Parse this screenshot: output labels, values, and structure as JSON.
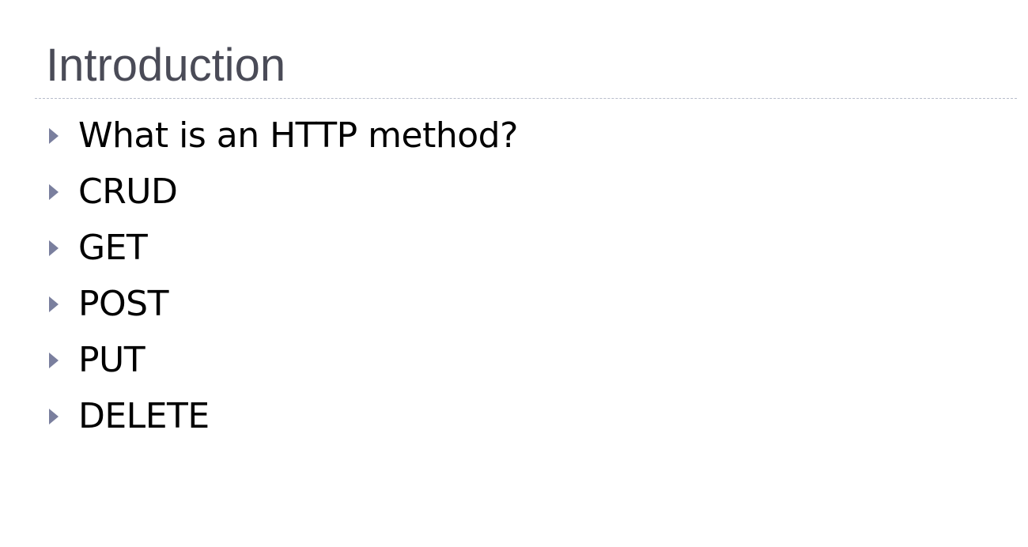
{
  "slide": {
    "title": "Introduction",
    "bullets": [
      {
        "text": "What is an HTTP method?"
      },
      {
        "text": "CRUD"
      },
      {
        "text": "GET"
      },
      {
        "text": "POST"
      },
      {
        "text": "PUT"
      },
      {
        "text": "DELETE"
      }
    ]
  },
  "colors": {
    "title": "#4a4b57",
    "bullet_marker": "#7a7f9e",
    "rule": "#b7bccb",
    "text": "#000000",
    "background": "#ffffff"
  },
  "icons": {
    "bullet": "triangle-bullet-icon"
  }
}
